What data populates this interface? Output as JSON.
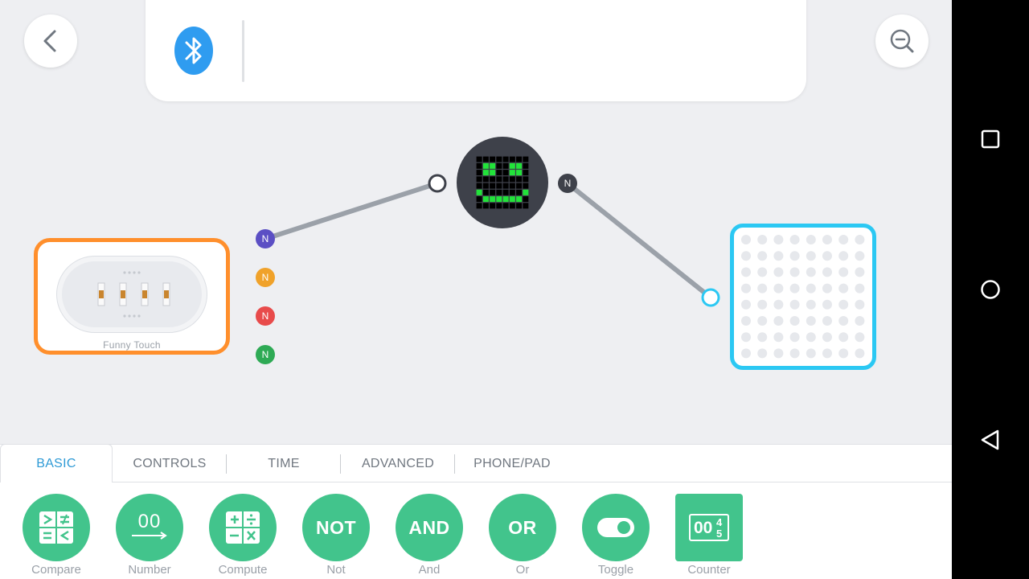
{
  "app": {
    "header": {
      "back_icon": "chevron-left-icon",
      "bluetooth_icon": "bluetooth-icon",
      "zoom_icon": "zoom-out-icon"
    },
    "canvas": {
      "nodes": {
        "touch": {
          "label": "Funny Touch",
          "border_color": "#ff8f2c"
        },
        "face": {
          "icon": "smiley-led-face"
        },
        "matrix": {
          "border_color": "#2bc8f3"
        }
      },
      "ports": [
        {
          "label": "N",
          "color": "#5b4fc4"
        },
        {
          "label": "N",
          "color": "#f0a22a"
        },
        {
          "label": "N",
          "color": "#e84b4b"
        },
        {
          "label": "N",
          "color": "#2eaa55"
        },
        {
          "label": "N",
          "color": "#3e414a"
        }
      ]
    },
    "tabs": [
      {
        "label": "BASIC",
        "active": true
      },
      {
        "label": "CONTROLS",
        "active": false
      },
      {
        "label": "TIME",
        "active": false
      },
      {
        "label": "ADVANCED",
        "active": false
      },
      {
        "label": "PHONE/PAD",
        "active": false
      }
    ],
    "palette": [
      {
        "label": "Compare",
        "icon": "compare-icon"
      },
      {
        "label": "Number",
        "icon": "number-icon",
        "icon_text": "00"
      },
      {
        "label": "Compute",
        "icon": "compute-icon"
      },
      {
        "label": "Not",
        "icon": "not-icon",
        "icon_text": "NOT"
      },
      {
        "label": "And",
        "icon": "and-icon",
        "icon_text": "AND"
      },
      {
        "label": "Or",
        "icon": "or-icon",
        "icon_text": "OR"
      },
      {
        "label": "Toggle",
        "icon": "toggle-icon"
      },
      {
        "label": "Counter",
        "icon": "counter-icon",
        "icon_text": "00"
      }
    ],
    "system_nav": [
      "square-recents-icon",
      "circle-home-icon",
      "triangle-back-icon"
    ],
    "colors": {
      "accent": "#2e9ad6",
      "block_green": "#42c48c",
      "bluetooth": "#2f9cf0"
    }
  }
}
